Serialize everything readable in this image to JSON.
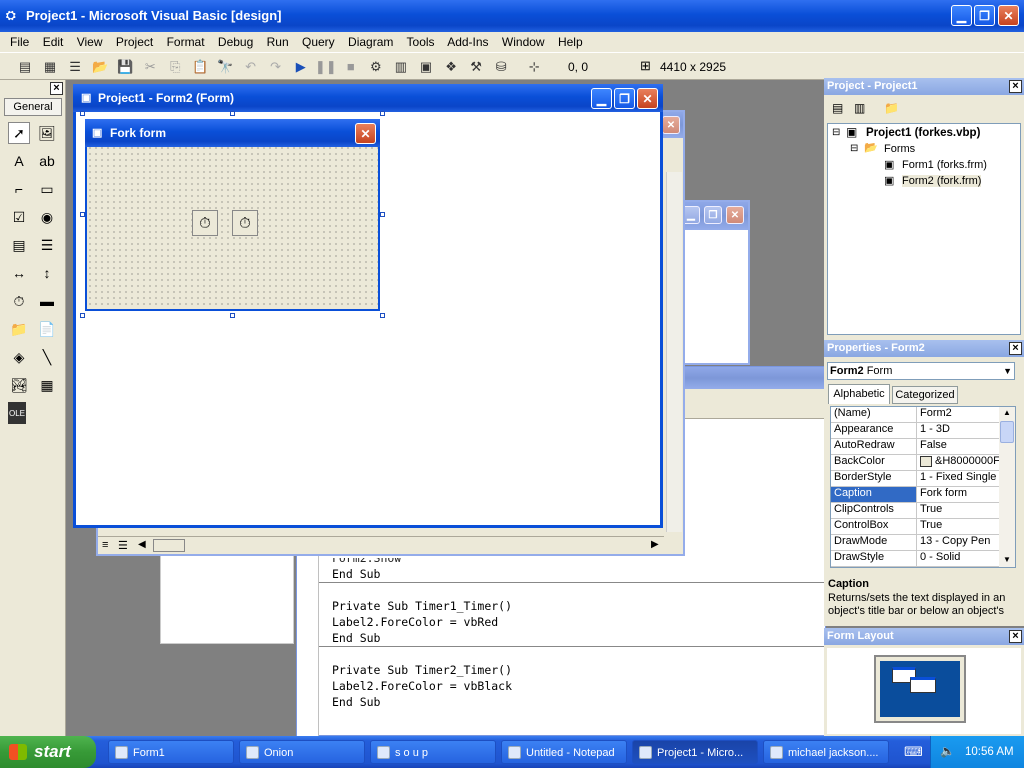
{
  "app": {
    "title": "Project1 - Microsoft Visual Basic [design]"
  },
  "menu": [
    "File",
    "Edit",
    "View",
    "Project",
    "Format",
    "Debug",
    "Run",
    "Query",
    "Diagram",
    "Tools",
    "Add-Ins",
    "Window",
    "Help"
  ],
  "toolbar": {
    "position_readout": "0, 0",
    "size_readout": "4410 x 2925"
  },
  "toolbox": {
    "tab_label": "General",
    "icons": [
      "pointer-icon",
      "picturebox-icon",
      "label-icon",
      "textbox-icon",
      "frame-icon",
      "commandbutton-icon",
      "checkbox-icon",
      "optionbutton-icon",
      "combobox-icon",
      "listbox-icon",
      "hscrollbar-icon",
      "vscrollbar-icon",
      "timer-icon",
      "drivelistbox-icon",
      "dirlistbox-icon",
      "filelistbox-icon",
      "shape-icon",
      "line-icon",
      "image-icon",
      "data-icon",
      "ole-icon"
    ]
  },
  "form_designer": {
    "title": "Project1 - Form2 (Form)"
  },
  "form": {
    "caption": "Fork form"
  },
  "code": {
    "lines": [
      "Form2.Show",
      "End Sub",
      "",
      "Private Sub Timer1_Timer()",
      "Label2.ForeColor = vbRed",
      "End Sub",
      "",
      "Private Sub Timer2_Timer()",
      "Label2.ForeColor = vbBlack",
      "End Sub"
    ]
  },
  "project": {
    "header": "Project - Project1",
    "root": "Project1 (forkes.vbp)",
    "folder": "Forms",
    "items": [
      "Form1 (forks.frm)",
      "Form2 (fork.frm)"
    ]
  },
  "properties": {
    "header": "Properties - Form2",
    "object_name": "Form2",
    "object_type": "Form",
    "tabs": [
      "Alphabetic",
      "Categorized"
    ],
    "rows": [
      {
        "name": "(Name)",
        "value": "Form2"
      },
      {
        "name": "Appearance",
        "value": "1 - 3D"
      },
      {
        "name": "AutoRedraw",
        "value": "False"
      },
      {
        "name": "BackColor",
        "value": "&H8000000F"
      },
      {
        "name": "BorderStyle",
        "value": "1 - Fixed Single"
      },
      {
        "name": "Caption",
        "value": "Fork form"
      },
      {
        "name": "ClipControls",
        "value": "True"
      },
      {
        "name": "ControlBox",
        "value": "True"
      },
      {
        "name": "DrawMode",
        "value": "13 - Copy Pen"
      },
      {
        "name": "DrawStyle",
        "value": "0 - Solid"
      }
    ],
    "desc_title": "Caption",
    "desc_text": "Returns/sets the text displayed in an object's title bar or below an object's"
  },
  "form_layout": {
    "header": "Form Layout"
  },
  "taskbar": {
    "start_label": "start",
    "buttons": [
      "Form1",
      "Onion",
      "s o u p",
      "Untitled - Notepad",
      "Project1 - Micro...",
      "michael jackson...."
    ],
    "clock": "10:56 AM"
  },
  "colors": {
    "xp_blue": "#0a4fd8",
    "taskbar": "#245edb",
    "start_green": "#3c9a3c",
    "selection": "#316ac5"
  }
}
